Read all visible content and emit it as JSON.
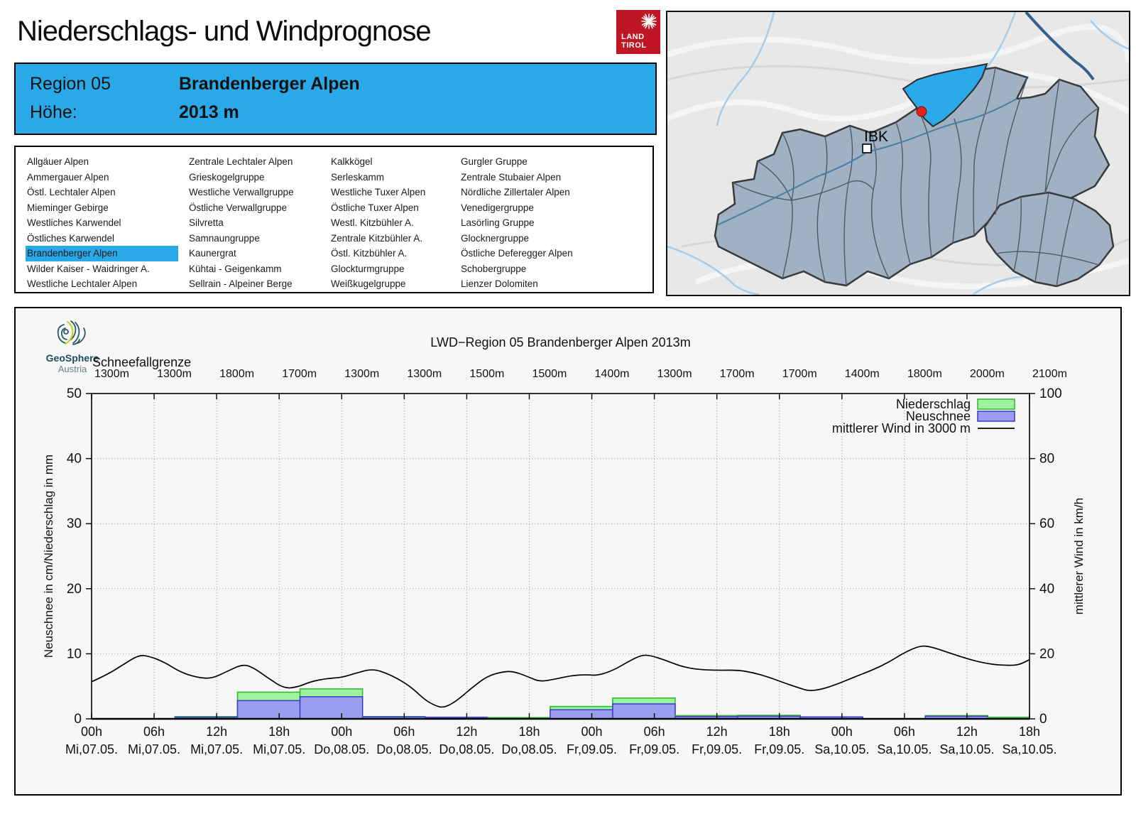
{
  "header": {
    "title": "Niederschlags- und Windprognose",
    "logo": {
      "line1": "LAND",
      "line2": "TIROL"
    }
  },
  "region_box": {
    "region_label": "Region 05",
    "region_name": "Brandenberger Alpen",
    "hoehe_label": "Höhe:",
    "hoehe_value": "2013 m"
  },
  "region_list": {
    "selected": "Brandenberger Alpen",
    "columns": [
      [
        "Allgäuer Alpen",
        "Ammergauer Alpen",
        "Östl. Lechtaler Alpen",
        "Mieminger Gebirge",
        "Westliches Karwendel",
        "Östliches Karwendel",
        "Brandenberger Alpen",
        "Wilder Kaiser - Waidringer A.",
        "Westliche Lechtaler Alpen"
      ],
      [
        "Zentrale Lechtaler Alpen",
        "Grieskogelgruppe",
        "Westliche Verwallgruppe",
        "Östliche Verwallgruppe",
        "Silvretta",
        "Samnaungruppe",
        "Kaunergrat",
        "Kühtai - Geigenkamm",
        "Sellrain - Alpeiner Berge"
      ],
      [
        "Kalkkögel",
        "Serleskamm",
        "Westliche Tuxer Alpen",
        "Östliche Tuxer Alpen",
        "Westl. Kitzbühler A.",
        "Zentrale Kitzbühler A.",
        "Östl. Kitzbühler A.",
        "Glockturmgruppe",
        "Weißkugelgruppe"
      ],
      [
        "Gurgler Gruppe",
        "Zentrale Stubaier Alpen",
        "Nördliche Zillertaler Alpen",
        "Venedigergruppe",
        "Lasörling Gruppe",
        "Glocknergruppe",
        "Östliche Deferegger Alpen",
        "Schobergruppe",
        "Lienzer Dolomiten"
      ]
    ]
  },
  "map": {
    "city_label": "IBK",
    "highlight_color": "#29a9e8",
    "marker_color": "#e32219"
  },
  "branding": {
    "geosphere_line1": "GeoSphere",
    "geosphere_line2": "Austria"
  },
  "chart_data": {
    "type": "bar",
    "title": "LWD−Region 05 Brandenberger Alpen 2013m",
    "snowline_label": "Schneefallgrenze",
    "snowline_values": [
      "1300m",
      "1300m",
      "1800m",
      "1700m",
      "1300m",
      "1300m",
      "1500m",
      "1500m",
      "1400m",
      "1300m",
      "1700m",
      "1700m",
      "1400m",
      "1800m",
      "2000m",
      "2100m"
    ],
    "ylabel_left": "Neuschnee in cm/Niederschlag in mm",
    "ylabel_right": "mittlerer Wind in km/h",
    "ylim_left": [
      0,
      50
    ],
    "ylim_right": [
      0,
      100
    ],
    "yticks_left": [
      0,
      10,
      20,
      30,
      40,
      50
    ],
    "yticks_right": [
      0,
      20,
      40,
      60,
      80,
      100
    ],
    "x_hours_range": [
      0,
      90
    ],
    "xticks": [
      {
        "hour": 0,
        "label": "00h",
        "date": "Mi,07.05."
      },
      {
        "hour": 6,
        "label": "06h",
        "date": "Mi,07.05."
      },
      {
        "hour": 12,
        "label": "12h",
        "date": "Mi,07.05."
      },
      {
        "hour": 18,
        "label": "18h",
        "date": "Mi,07.05."
      },
      {
        "hour": 24,
        "label": "00h",
        "date": "Do,08.05."
      },
      {
        "hour": 30,
        "label": "06h",
        "date": "Do,08.05."
      },
      {
        "hour": 36,
        "label": "12h",
        "date": "Do,08.05."
      },
      {
        "hour": 42,
        "label": "18h",
        "date": "Do,08.05."
      },
      {
        "hour": 48,
        "label": "00h",
        "date": "Fr,09.05."
      },
      {
        "hour": 54,
        "label": "06h",
        "date": "Fr,09.05."
      },
      {
        "hour": 60,
        "label": "12h",
        "date": "Fr,09.05."
      },
      {
        "hour": 66,
        "label": "18h",
        "date": "Fr,09.05."
      },
      {
        "hour": 72,
        "label": "00h",
        "date": "Sa,10.05."
      },
      {
        "hour": 78,
        "label": "06h",
        "date": "Sa,10.05."
      },
      {
        "hour": 84,
        "label": "12h",
        "date": "Sa,10.05."
      },
      {
        "hour": 90,
        "label": "18h",
        "date": "Sa,10.05."
      }
    ],
    "legend": [
      {
        "label": "Niederschlag",
        "type": "box",
        "fill": "#9df29d",
        "border": "#2db82d"
      },
      {
        "label": "Neuschnee",
        "type": "box",
        "fill": "#9c9cf0",
        "border": "#3a3aca"
      },
      {
        "label": "mittlerer Wind in 3000 m",
        "type": "line",
        "color": "#000000"
      }
    ],
    "bars_unit_hint": "niederschlag_mm on left axis mm, neuschnee_cm on left axis cm",
    "bars": [
      {
        "start": 8,
        "end": 14,
        "niederschlag_mm": 0.35,
        "neuschnee_cm": 0.25
      },
      {
        "start": 14,
        "end": 20,
        "niederschlag_mm": 4.1,
        "neuschnee_cm": 2.8
      },
      {
        "start": 20,
        "end": 26,
        "niederschlag_mm": 4.6,
        "neuschnee_cm": 3.4
      },
      {
        "start": 26,
        "end": 32,
        "niederschlag_mm": 0.35,
        "neuschnee_cm": 0.3
      },
      {
        "start": 32,
        "end": 38,
        "niederschlag_mm": 0.25,
        "neuschnee_cm": 0.25
      },
      {
        "start": 38,
        "end": 44,
        "niederschlag_mm": 0.2,
        "neuschnee_cm": 0
      },
      {
        "start": 44,
        "end": 50,
        "niederschlag_mm": 1.9,
        "neuschnee_cm": 1.4
      },
      {
        "start": 50,
        "end": 56,
        "niederschlag_mm": 3.2,
        "neuschnee_cm": 2.3
      },
      {
        "start": 56,
        "end": 62,
        "niederschlag_mm": 0.5,
        "neuschnee_cm": 0.35
      },
      {
        "start": 62,
        "end": 68,
        "niederschlag_mm": 0.55,
        "neuschnee_cm": 0.4
      },
      {
        "start": 68,
        "end": 74,
        "niederschlag_mm": 0.1,
        "neuschnee_cm": 0.3
      },
      {
        "start": 80,
        "end": 86,
        "niederschlag_mm": 0.5,
        "neuschnee_cm": 0.4
      },
      {
        "start": 86,
        "end": 90,
        "niederschlag_mm": 0.25,
        "neuschnee_cm": 0
      }
    ],
    "wind_points_kmh": [
      [
        0,
        11.4
      ],
      [
        1.5,
        13.6
      ],
      [
        3,
        16.6
      ],
      [
        4.5,
        19.6
      ],
      [
        5.5,
        19.3
      ],
      [
        7,
        17.4
      ],
      [
        8.5,
        14.4
      ],
      [
        10,
        12.8
      ],
      [
        11.5,
        12.3
      ],
      [
        13,
        14.6
      ],
      [
        14.5,
        16.8
      ],
      [
        15.5,
        15.8
      ],
      [
        17,
        12.4
      ],
      [
        18.5,
        9.3
      ],
      [
        19.8,
        9.8
      ],
      [
        21,
        11.4
      ],
      [
        22.5,
        12.4
      ],
      [
        24,
        12.7
      ],
      [
        25.5,
        14.2
      ],
      [
        27,
        15.4
      ],
      [
        28.5,
        13.8
      ],
      [
        30,
        11.2
      ],
      [
        31,
        8.8
      ],
      [
        32,
        5.8
      ],
      [
        33,
        4.0
      ],
      [
        33.8,
        3.4
      ],
      [
        35,
        5.4
      ],
      [
        36.5,
        9.6
      ],
      [
        38,
        13.2
      ],
      [
        39.5,
        14.5
      ],
      [
        40.5,
        14.6
      ],
      [
        42,
        12.8
      ],
      [
        43,
        11.4
      ],
      [
        44.5,
        12.2
      ],
      [
        46,
        13.3
      ],
      [
        47.5,
        13.6
      ],
      [
        48.5,
        13.3
      ],
      [
        50,
        14.8
      ],
      [
        51.5,
        17.6
      ],
      [
        52.7,
        19.5
      ],
      [
        53.5,
        19.6
      ],
      [
        55,
        18.1
      ],
      [
        56.5,
        16.2
      ],
      [
        58,
        15.2
      ],
      [
        60,
        14.9
      ],
      [
        62,
        15.0
      ],
      [
        63.5,
        14.2
      ],
      [
        65,
        12.8
      ],
      [
        66.5,
        11.0
      ],
      [
        68,
        9.4
      ],
      [
        68.8,
        8.6
      ],
      [
        70,
        9.0
      ],
      [
        71.5,
        10.6
      ],
      [
        73,
        12.6
      ],
      [
        75,
        15.1
      ],
      [
        76.5,
        17.4
      ],
      [
        78,
        20.4
      ],
      [
        79.5,
        22.5
      ],
      [
        80.5,
        22.2
      ],
      [
        82,
        20.6
      ],
      [
        83.5,
        19.0
      ],
      [
        85,
        17.6
      ],
      [
        86.5,
        16.7
      ],
      [
        88,
        16.4
      ],
      [
        89,
        16.6
      ],
      [
        90,
        18.2
      ]
    ],
    "grid": true,
    "legend_position": "top-right"
  }
}
